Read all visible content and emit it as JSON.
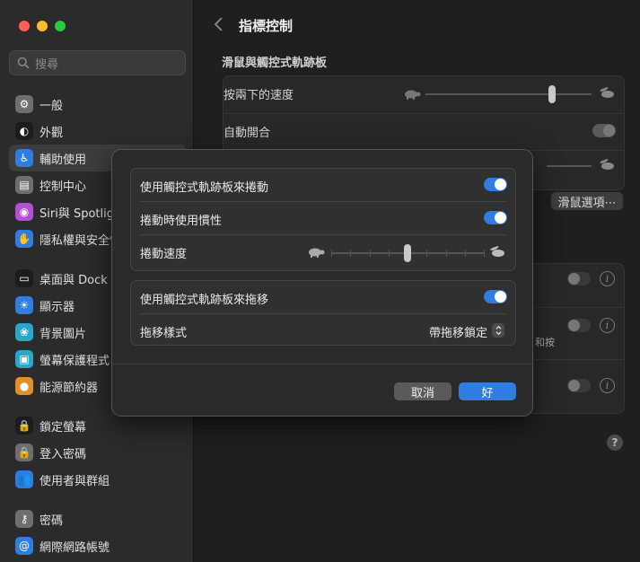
{
  "sidebar": {
    "search_placeholder": "搜尋",
    "items": [
      {
        "label": "一般",
        "icon": "gear-icon",
        "color": "#6e6e6e"
      },
      {
        "label": "外觀",
        "icon": "appearance-icon",
        "color": "#1c1c1c"
      },
      {
        "label": "輔助使用",
        "icon": "accessibility-icon",
        "color": "#2f7de1",
        "selected": true
      },
      {
        "label": "控制中心",
        "icon": "control-center-icon",
        "color": "#6e6e6e"
      },
      {
        "label": "Siri與 Spotlight",
        "icon": "siri-icon",
        "color": "#b44fd6"
      },
      {
        "label": "隱私權與安全性",
        "icon": "hand-icon",
        "color": "#2f7de1"
      },
      {
        "label": "桌面與 Dock",
        "icon": "dock-icon",
        "color": "#1c1c1c"
      },
      {
        "label": "顯示器",
        "icon": "sun-icon",
        "color": "#2f7de1"
      },
      {
        "label": "背景圖片",
        "icon": "wallpaper-icon",
        "color": "#2aa6c9"
      },
      {
        "label": "螢幕保護程式",
        "icon": "screensaver-icon",
        "color": "#2aa6c9"
      },
      {
        "label": "能源節約器",
        "icon": "bulb-icon",
        "color": "#e0902a"
      },
      {
        "label": "鎖定螢幕",
        "icon": "lock-screen-icon",
        "color": "#1c1c1c"
      },
      {
        "label": "登入密碼",
        "icon": "lock-icon",
        "color": "#6e6e6e"
      },
      {
        "label": "使用者與群組",
        "icon": "users-icon",
        "color": "#2f7de1"
      },
      {
        "label": "密碼",
        "icon": "key-icon",
        "color": "#6e6e6e"
      },
      {
        "label": "網際網路帳號",
        "icon": "at-icon",
        "color": "#2f7de1"
      }
    ]
  },
  "main": {
    "title": "指標控制",
    "section_title": "滑鼠與觸控式軌跡板",
    "double_click_label": "按兩下的速度",
    "spring_load_label": "自動開合",
    "trackpad_options_button": "滑鼠選項⋯",
    "partial_text": "和按",
    "double_click_speed_fraction": 0.76,
    "tracking_fraction": 0.82
  },
  "dialog": {
    "scroll_with_trackpad": "使用觸控式軌跡板來捲動",
    "scroll_with_trackpad_on": true,
    "inertia": "捲動時使用慣性",
    "inertia_on": true,
    "scroll_speed": "捲動速度",
    "scroll_speed_fraction": 0.5,
    "drag_with_trackpad": "使用觸控式軌跡板來拖移",
    "drag_with_trackpad_on": true,
    "drag_style_label": "拖移樣式",
    "drag_style_value": "帶拖移鎖定",
    "cancel": "取消",
    "ok": "好"
  },
  "colors": {
    "accent": "#2f7de1",
    "sidebar_bg": "#2b2b2b",
    "dialog_bg": "#2a2a2a"
  }
}
